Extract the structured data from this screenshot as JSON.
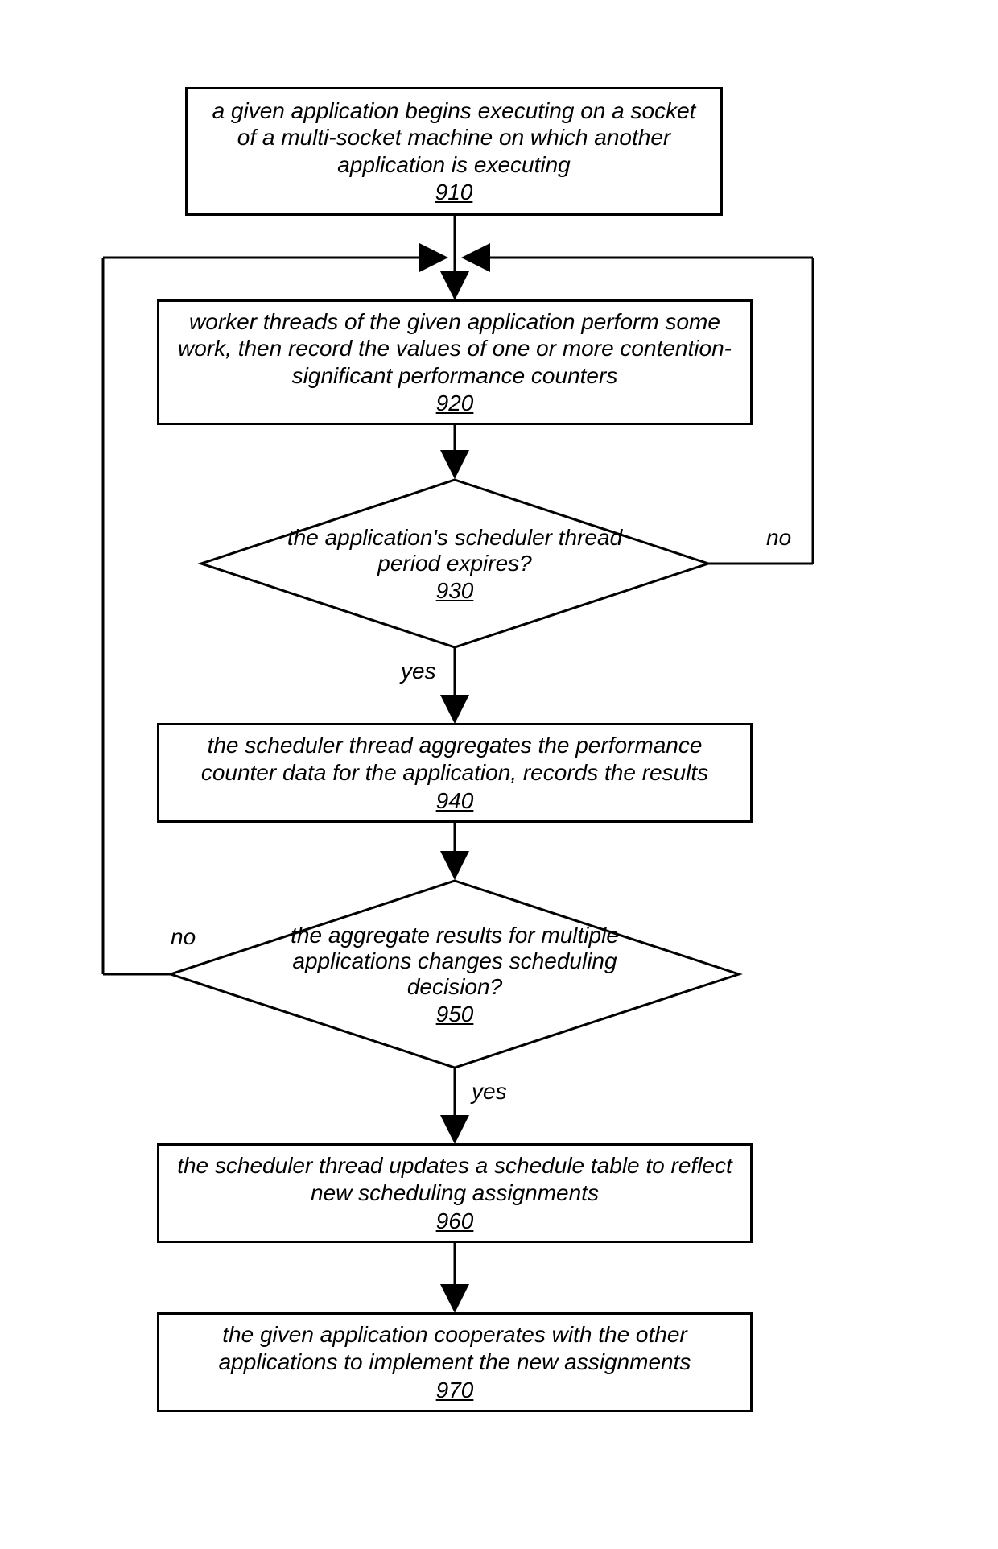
{
  "chart_data": {
    "type": "flowchart",
    "nodes": [
      {
        "id": "910",
        "shape": "rect",
        "text": "a given application begins executing on a socket of a multi-socket machine on which another application is executing",
        "ref": "910"
      },
      {
        "id": "920",
        "shape": "rect",
        "text": "worker threads of the given application perform some work, then record the values of one or more contention-significant performance counters",
        "ref": "920"
      },
      {
        "id": "930",
        "shape": "diamond",
        "text": "the application's scheduler thread period expires?",
        "ref": "930"
      },
      {
        "id": "940",
        "shape": "rect",
        "text": "the scheduler thread aggregates the performance counter data for the application, records the results",
        "ref": "940"
      },
      {
        "id": "950",
        "shape": "diamond",
        "text": "the aggregate results for multiple applications changes scheduling decision?",
        "ref": "950"
      },
      {
        "id": "960",
        "shape": "rect",
        "text": "the scheduler thread updates a schedule table to reflect new scheduling assignments",
        "ref": "960"
      },
      {
        "id": "970",
        "shape": "rect",
        "text": "the given application cooperates with the other applications to implement the new assignments",
        "ref": "970"
      }
    ],
    "edges": [
      {
        "from": "910",
        "to": "920",
        "label": ""
      },
      {
        "from": "920",
        "to": "930",
        "label": ""
      },
      {
        "from": "930",
        "to": "920",
        "label": "no"
      },
      {
        "from": "930",
        "to": "940",
        "label": "yes"
      },
      {
        "from": "940",
        "to": "950",
        "label": ""
      },
      {
        "from": "950",
        "to": "920",
        "label": "no"
      },
      {
        "from": "950",
        "to": "960",
        "label": "yes"
      },
      {
        "from": "960",
        "to": "970",
        "label": ""
      }
    ]
  },
  "labels": {
    "yes": "yes",
    "no": "no"
  }
}
